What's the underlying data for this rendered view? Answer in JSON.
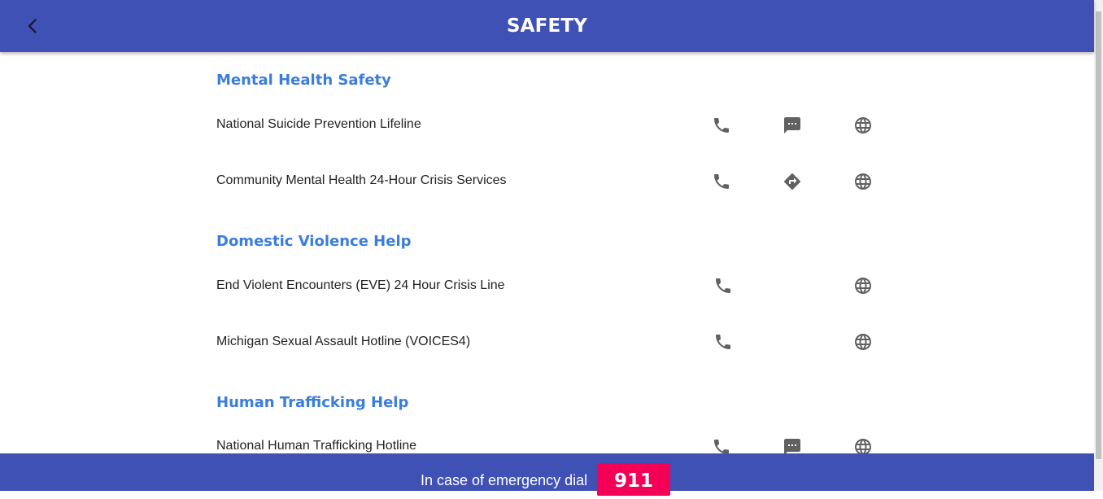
{
  "header": {
    "title": "SAFETY",
    "back_icon": "chevron-left-icon"
  },
  "colors": {
    "app_bar": "#3f51b5",
    "section_title": "#3b7ddd",
    "emergency_badge": "#f50057",
    "icon": "#616161"
  },
  "sections": [
    {
      "title": "Mental Health Safety",
      "items": [
        {
          "label": "National Suicide Prevention Lifeline",
          "actions": [
            "phone-icon",
            "sms-icon",
            "globe-icon"
          ]
        },
        {
          "label": "Community Mental Health 24-Hour Crisis Services",
          "actions": [
            "phone-icon",
            "directions-icon",
            "globe-icon"
          ]
        }
      ]
    },
    {
      "title": "Domestic Violence Help",
      "items": [
        {
          "label": "End Violent Encounters (EVE) 24 Hour Crisis Line",
          "actions": [
            "phone-icon",
            "globe-icon"
          ]
        },
        {
          "label": "Michigan Sexual Assault Hotline (VOICES4)",
          "actions": [
            "phone-icon",
            "globe-icon"
          ]
        }
      ]
    },
    {
      "title": "Human Trafficking Help",
      "items": [
        {
          "label": "National Human Trafficking Hotline",
          "actions": [
            "phone-icon",
            "sms-icon",
            "globe-icon"
          ]
        }
      ]
    }
  ],
  "footer": {
    "text": "In case of emergency dial",
    "number": "911"
  }
}
